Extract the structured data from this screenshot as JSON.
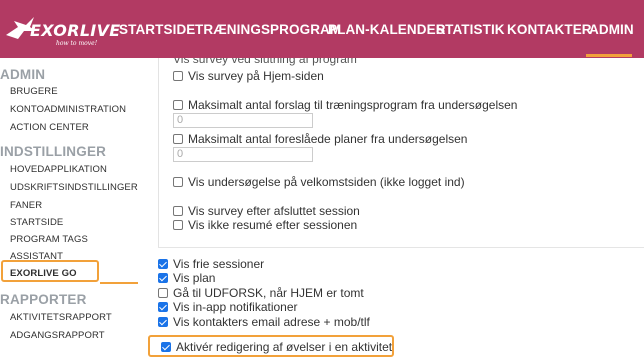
{
  "app": {
    "brand": "EXORLIVE",
    "tagline": "how to move!"
  },
  "nav": {
    "items": [
      {
        "label": "STARTSIDE"
      },
      {
        "label": "TRÆNINGSPROGRAM"
      },
      {
        "label": "PLAN-KALENDER"
      },
      {
        "label": "STATISTIK"
      },
      {
        "label": "KONTAKTER"
      },
      {
        "label": "ADMIN",
        "active": true
      }
    ]
  },
  "sidebar": {
    "admin_title": "ADMIN",
    "admin_items": [
      {
        "label": "BRUGERE"
      },
      {
        "label": "KONTOADMINISTRATION"
      },
      {
        "label": "ACTION CENTER"
      }
    ],
    "settings_title": "INDSTILLINGER",
    "settings_items": [
      {
        "label": "HOVEDAPPLIKATION"
      },
      {
        "label": "UDSKRIFTSINDSTILLINGER"
      },
      {
        "label": "FANER"
      },
      {
        "label": "STARTSIDE"
      },
      {
        "label": "PROGRAM TAGS"
      },
      {
        "label": "ASSISTANT"
      },
      {
        "label": "EXORLIVE GO",
        "active": true
      }
    ],
    "reports_title": "RAPPORTER",
    "reports_items": [
      {
        "label": "AKTIVITETSRAPPORT"
      },
      {
        "label": "ADGANGSRAPPORT"
      }
    ]
  },
  "panel": {
    "partial_label": "Vis survey ved slutning af program",
    "options": [
      {
        "label": "Vis survey på Hjem-siden",
        "checked": false
      },
      {
        "label": "Maksimalt antal forslag til træningsprogram fra undersøgelsen",
        "checked": false,
        "value": "0"
      },
      {
        "label": "Maksimalt antal foreslåede planer fra undersøgelsen",
        "checked": false,
        "value": "0"
      },
      {
        "label": "Vis undersøgelse på velkomstsiden (ikke logget ind)",
        "checked": false
      },
      {
        "label": "Vis survey efter afsluttet session",
        "checked": false
      },
      {
        "label": "Vis ikke resumé efter sessionen",
        "checked": false
      }
    ]
  },
  "settings": {
    "options": [
      {
        "label": "Vis frie sessioner",
        "checked": true
      },
      {
        "label": "Vis plan",
        "checked": true
      },
      {
        "label": "Gå til UDFORSK, når HJEM er tomt",
        "checked": false
      },
      {
        "label": "Vis in-app notifikationer",
        "checked": true
      },
      {
        "label": "Vis kontakters email adrese + mob/tlf",
        "checked": true
      },
      {
        "label": "Aktivér redigering af øvelser i en aktivitet",
        "checked": true
      }
    ]
  },
  "colors": {
    "header_bg": "#b23a63",
    "accent_orange": "#f2a13a",
    "checkbox_blue": "#1a73e8"
  }
}
